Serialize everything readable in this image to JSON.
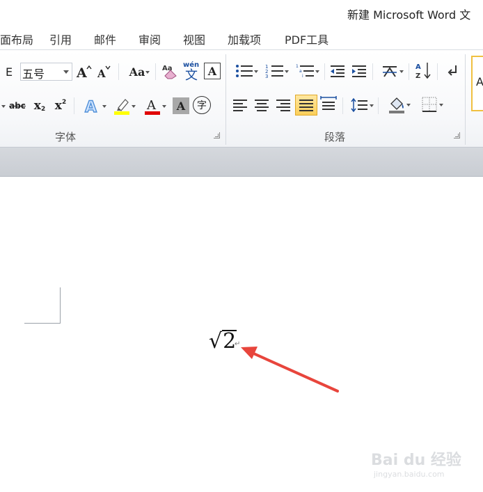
{
  "window": {
    "title": "新建 Microsoft Word 文"
  },
  "menu": {
    "tabs": [
      {
        "label": "面布局"
      },
      {
        "label": "引用"
      },
      {
        "label": "邮件"
      },
      {
        "label": "审阅"
      },
      {
        "label": "视图"
      },
      {
        "label": "加载项"
      },
      {
        "label": "PDF工具"
      }
    ]
  },
  "ribbon": {
    "font": {
      "group_label": "字体",
      "font_name_partial": "E",
      "font_size": "五号",
      "aa_label": "Aa",
      "wen_label": "wén",
      "wen_char": "文",
      "char_border_label": "A",
      "abc_label": "abc",
      "sub_label": "x",
      "sup_label": "x",
      "text_effect_label": "A",
      "font_color_label": "A",
      "shade_label": "A",
      "enclose_char": "字",
      "highlight_color": "#ffff00",
      "font_color": "#e00000"
    },
    "paragraph": {
      "group_label": "段落",
      "sort_label": "A Z",
      "style_sample": "A"
    }
  },
  "document": {
    "formula_content": "2",
    "paragraph_mark": "↵"
  },
  "watermark": {
    "brand": "Bai du 经验",
    "url": "jingyan.baidu.com"
  },
  "annotation": {
    "arrow_color": "#e8453c"
  }
}
